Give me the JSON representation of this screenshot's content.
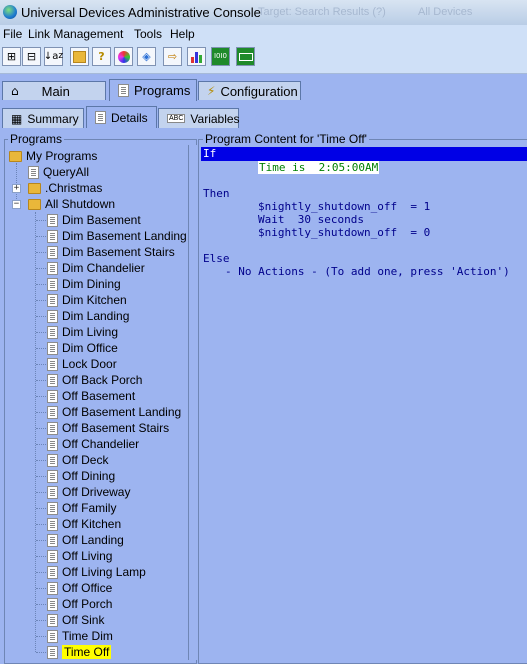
{
  "window": {
    "title": "Universal Devices Administrative Console",
    "ghost_text": [
      "Target: Search Results (?)",
      "All Devices"
    ]
  },
  "menu": [
    "File",
    "Link Management",
    "Tools",
    "Help"
  ],
  "toolbar": {
    "icons": [
      "expand-all-icon",
      "collapse-all-icon",
      "sort-az-icon",
      "folder-icon",
      "help-icon",
      "color-icon",
      "scene-icon",
      "move-icon",
      "chart-icon",
      "io-icon",
      "link-icon"
    ],
    "sort_glyph": "z",
    "help_glyph": "?",
    "io_glyph": "I0I0"
  },
  "tabs": {
    "main": "Main",
    "programs": "Programs",
    "configuration": "Configuration"
  },
  "subtabs": {
    "summary": "Summary",
    "details": "Details",
    "variables": "Variables",
    "abc": "ABC"
  },
  "programs_panel": {
    "label": "Programs",
    "root": "My Programs",
    "items": [
      "QueryAll",
      ".Christmas",
      "All Shutdown"
    ],
    "children": [
      "Dim Basement",
      "Dim Basement Landing",
      "Dim Basement Stairs",
      "Dim Chandelier",
      "Dim Dining",
      "Dim Kitchen",
      "Dim Landing",
      "Dim Living",
      "Dim Office",
      "Lock Door",
      "Off Back Porch",
      "Off Basement",
      "Off Basement Landing",
      "Off Basement Stairs",
      "Off Chandelier",
      "Off Deck",
      "Off Dining",
      "Off Driveway",
      "Off Family",
      "Off Kitchen",
      "Off Landing",
      "Off Living",
      "Off Living Lamp",
      "Off Office",
      "Off Porch",
      "Off Sink",
      "Time Dim",
      "Time Off"
    ],
    "selected": "Time Off"
  },
  "program_content": {
    "label": "Program Content for 'Time Off'",
    "if_label": "If",
    "condition": "Time is  2:05:00AM",
    "then_label": "Then",
    "then_lines": [
      "$nightly_shutdown_off  = 1",
      "Wait  30 seconds",
      "$nightly_shutdown_off  = 0"
    ],
    "else_label": "Else",
    "else_line": "- No Actions - (To add one, press 'Action')"
  }
}
